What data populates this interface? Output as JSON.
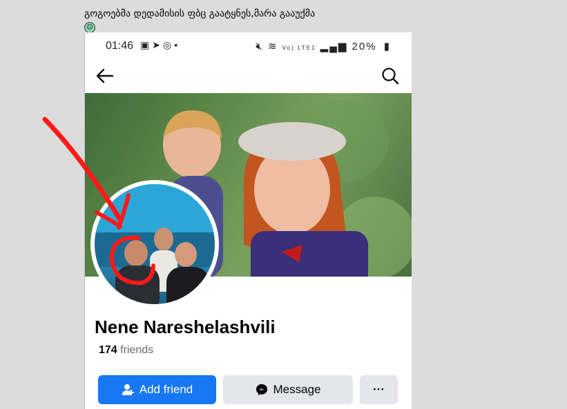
{
  "post": {
    "caption": "გოგოებმა დედამისის ფბც გაატყნეს,მარა გააუქმა"
  },
  "status_bar": {
    "time": "01:46",
    "dot": "•",
    "signal_text": "Vo) LTE1",
    "battery": "20%"
  },
  "profile": {
    "name": "Nene Nareshelashvili",
    "friends_count": "174",
    "friends_label": "friends"
  },
  "actions": {
    "add_friend": "Add friend",
    "message": "Message",
    "more": "···"
  },
  "colors": {
    "primary": "#1877f2",
    "secondary_btn": "#e4e6eb",
    "annotation": "#ff1a1a"
  },
  "icons": [
    "back-arrow-icon",
    "search-icon",
    "add-friend-icon",
    "messenger-icon",
    "gallery-icon",
    "telegram-icon",
    "whatsapp-icon",
    "mute-icon",
    "wifi-icon",
    "signal-icon",
    "battery-icon"
  ]
}
